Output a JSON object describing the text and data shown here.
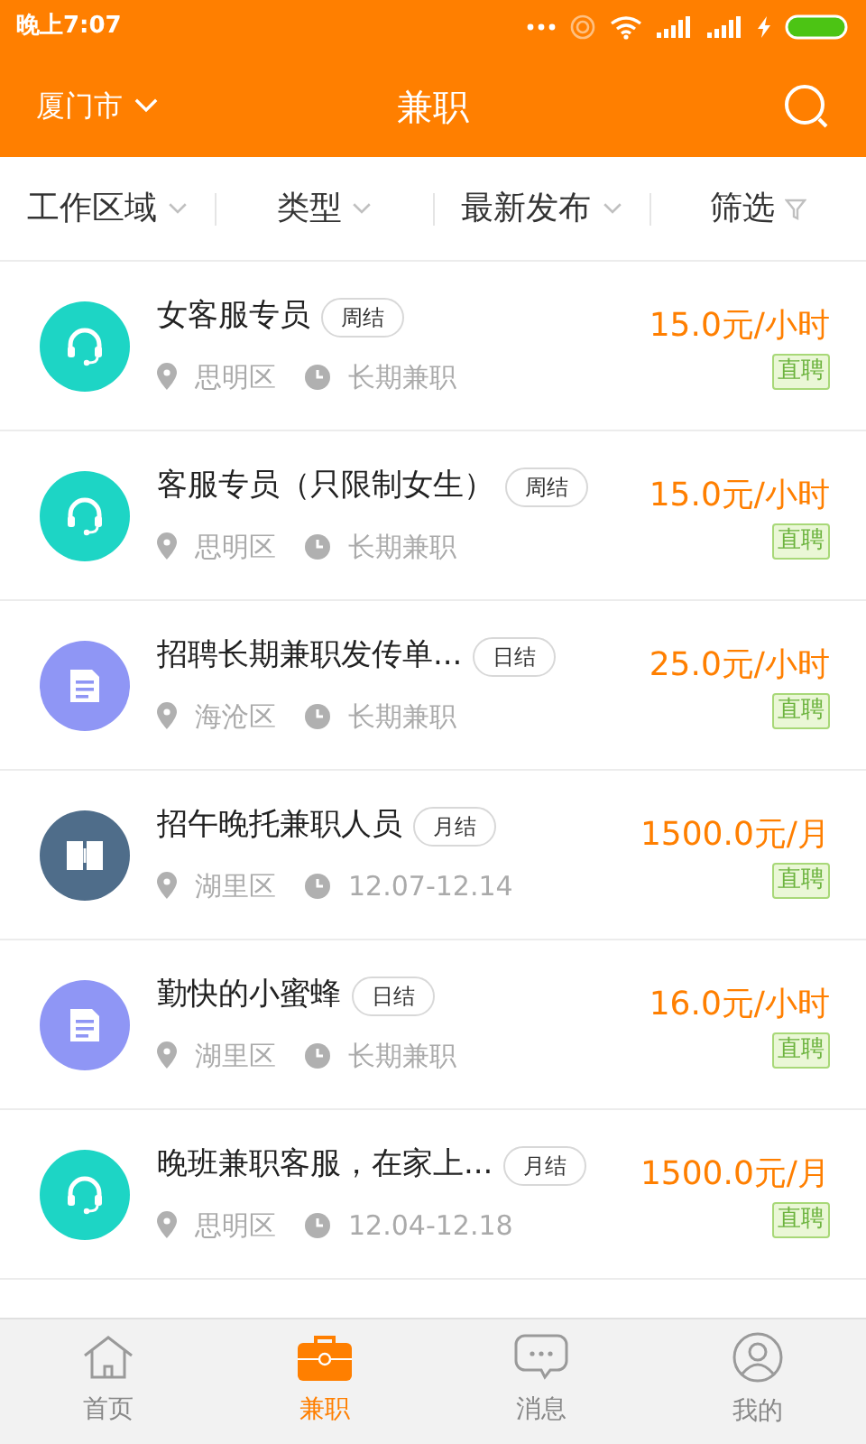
{
  "status_bar": {
    "time": "晚上7:07"
  },
  "header": {
    "city": "厦门市",
    "title": "兼职"
  },
  "filters": [
    {
      "label": "工作区域",
      "kind": "dropdown"
    },
    {
      "label": "类型",
      "kind": "dropdown"
    },
    {
      "label": "最新发布",
      "kind": "dropdown"
    },
    {
      "label": "筛选",
      "kind": "filter"
    }
  ],
  "jobs": [
    {
      "kind": "headset",
      "color": "#1dd5c5",
      "title": "女客服专员",
      "settlement": "周结",
      "district": "思明区",
      "period": "长期兼职",
      "pay": "15.0元/小时",
      "badge": "直聘"
    },
    {
      "kind": "headset",
      "color": "#1dd5c5",
      "title": "客服专员（只限制女生）",
      "settlement": "周结",
      "district": "思明区",
      "period": "长期兼职",
      "pay": "15.0元/小时",
      "badge": "直聘"
    },
    {
      "kind": "document",
      "color": "#8f96f5",
      "title": "招聘长期兼职发传单...",
      "settlement": "日结",
      "district": "海沧区",
      "period": "长期兼职",
      "pay": "25.0元/小时",
      "badge": "直聘"
    },
    {
      "kind": "book",
      "color": "#4f6d8a",
      "title": "招午晚托兼职人员",
      "settlement": "月结",
      "district": "湖里区",
      "period": "12.07-12.14",
      "pay": "1500.0元/月",
      "badge": "直聘"
    },
    {
      "kind": "document",
      "color": "#8f96f5",
      "title": "勤快的小蜜蜂",
      "settlement": "日结",
      "district": "湖里区",
      "period": "长期兼职",
      "pay": "16.0元/小时",
      "badge": "直聘"
    },
    {
      "kind": "headset",
      "color": "#1dd5c5",
      "title": "晚班兼职客服，在家上...",
      "settlement": "月结",
      "district": "思明区",
      "period": "12.04-12.18",
      "pay": "1500.0元/月",
      "badge": "直聘"
    }
  ],
  "tab_bar": [
    {
      "label": "首页",
      "selected": false
    },
    {
      "label": "兼职",
      "selected": true
    },
    {
      "label": "消息",
      "selected": false
    },
    {
      "label": "我的",
      "selected": false
    }
  ]
}
